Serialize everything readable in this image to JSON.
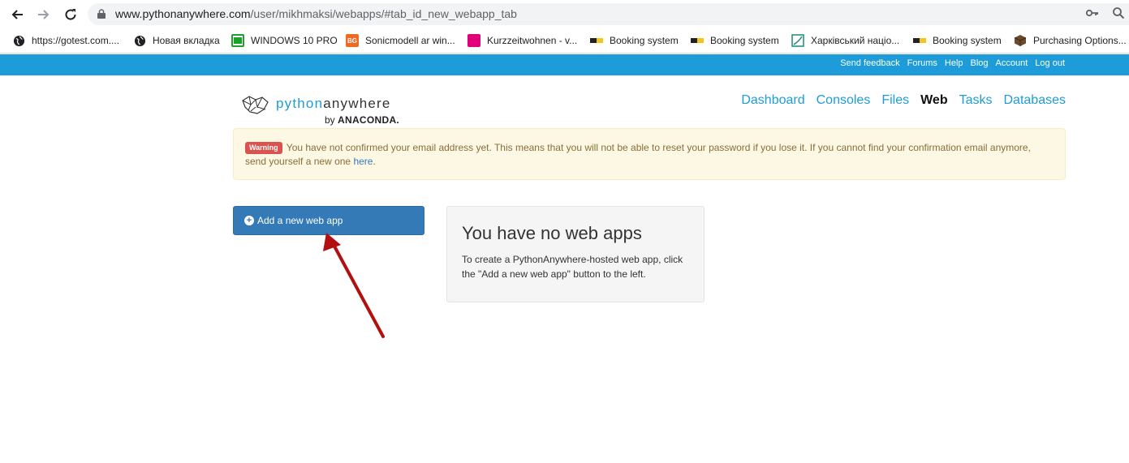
{
  "browser": {
    "url_host": "www.pythonanywhere.com",
    "url_path": "/user/mikhmaksi/webapps/#tab_id_new_webapp_tab",
    "bookmarks": [
      {
        "label": "https://gotest.com....",
        "icon": "globe-icon"
      },
      {
        "label": "Новая вкладка",
        "icon": "globe-icon"
      },
      {
        "label": "WINDOWS 10 PRO",
        "icon": "windows-icon"
      },
      {
        "label": "Sonicmodell ar win...",
        "icon": "bg-icon",
        "icon_text": "BG"
      },
      {
        "label": "Kurzzeitwohnen - v...",
        "icon": "kurz-icon"
      },
      {
        "label": "Booking system",
        "icon": "booking-icon"
      },
      {
        "label": "Booking system",
        "icon": "booking-icon"
      },
      {
        "label": "Харківський націо...",
        "icon": "university-icon"
      },
      {
        "label": "Booking system",
        "icon": "booking-icon"
      },
      {
        "label": "Purchasing Options...",
        "icon": "box-icon"
      }
    ]
  },
  "site": {
    "top_links": [
      "Send feedback",
      "Forums",
      "Help",
      "Blog",
      "Account",
      "Log out"
    ],
    "logo": {
      "part1": "python",
      "part2": "anywhere",
      "by": "by",
      "brand": "ANACONDA."
    },
    "nav": [
      {
        "label": "Dashboard",
        "active": false
      },
      {
        "label": "Consoles",
        "active": false
      },
      {
        "label": "Files",
        "active": false
      },
      {
        "label": "Web",
        "active": true
      },
      {
        "label": "Tasks",
        "active": false
      },
      {
        "label": "Databases",
        "active": false
      }
    ],
    "warning": {
      "badge": "Warning",
      "text": "You have not confirmed your email address yet. This means that you will not be able to reset your password if you lose it. If you cannot find your confirmation email anymore, send yourself a new one",
      "link": "here",
      "end": "."
    },
    "add_button_label": "Add a new web app",
    "empty_state": {
      "title": "You have no web apps",
      "text": "To create a PythonAnywhere-hosted web app, click the \"Add a new web app\" button to the left."
    }
  },
  "colors": {
    "accent": "#1d9cd9",
    "button": "#337ab7",
    "annotation_arrow": "#b30f0f"
  }
}
